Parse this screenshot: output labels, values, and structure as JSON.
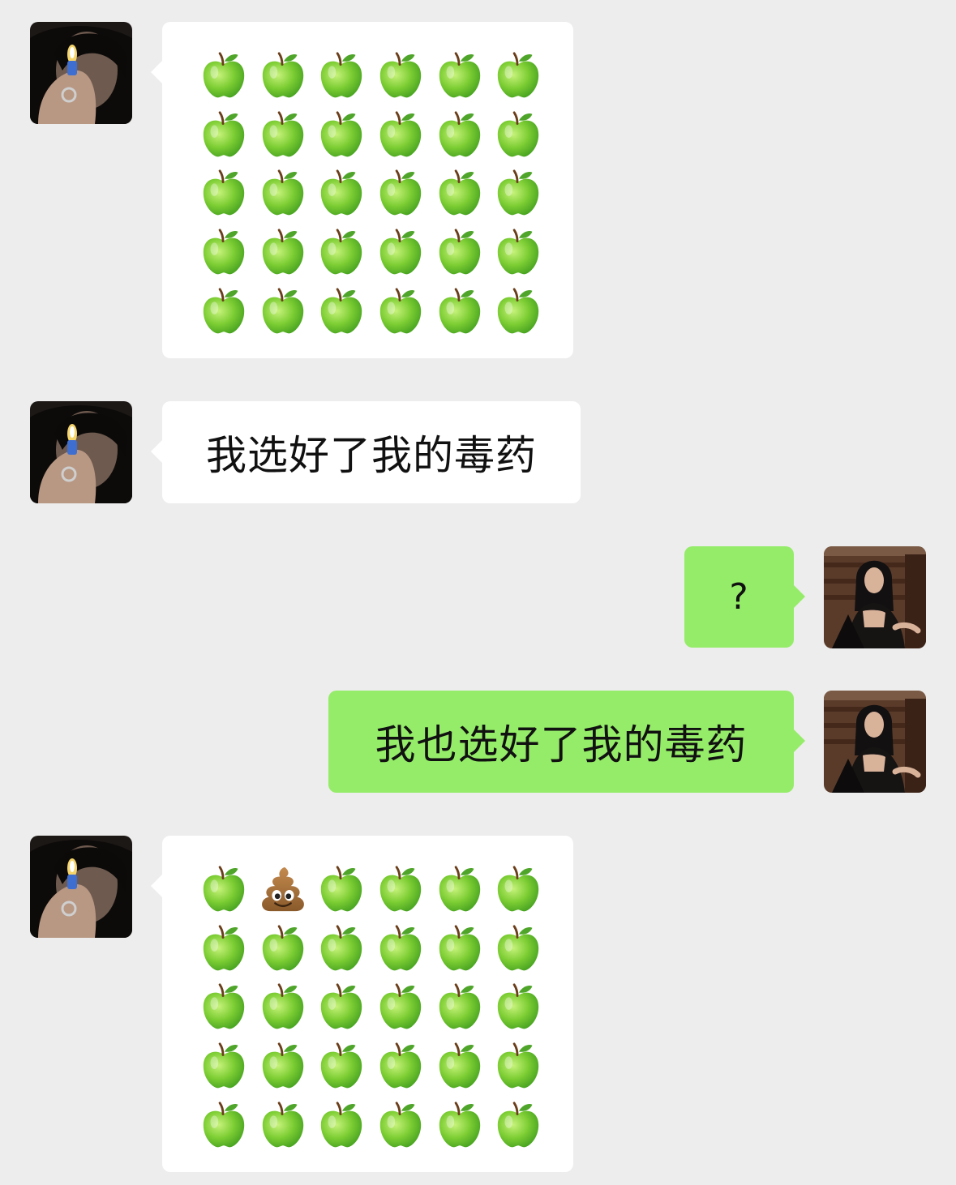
{
  "messages": [
    {
      "side": "left",
      "type": "emoji-grid",
      "items": [
        "apple",
        "apple",
        "apple",
        "apple",
        "apple",
        "apple",
        "apple",
        "apple",
        "apple",
        "apple",
        "apple",
        "apple",
        "apple",
        "apple",
        "apple",
        "apple",
        "apple",
        "apple",
        "apple",
        "apple",
        "apple",
        "apple",
        "apple",
        "apple",
        "apple",
        "apple",
        "apple",
        "apple",
        "apple",
        "apple"
      ]
    },
    {
      "side": "left",
      "type": "text",
      "text": "我选好了我的毒药"
    },
    {
      "side": "right",
      "type": "text",
      "text": "?"
    },
    {
      "side": "right",
      "type": "text",
      "text": "我也选好了我的毒药"
    },
    {
      "side": "left",
      "type": "emoji-grid",
      "items": [
        "apple",
        "poop",
        "apple",
        "apple",
        "apple",
        "apple",
        "apple",
        "apple",
        "apple",
        "apple",
        "apple",
        "apple",
        "apple",
        "apple",
        "apple",
        "apple",
        "apple",
        "apple",
        "apple",
        "apple",
        "apple",
        "apple",
        "apple",
        "apple",
        "apple",
        "apple",
        "apple",
        "apple",
        "apple",
        "apple"
      ]
    }
  ],
  "icons": {
    "apple": "green-apple-icon",
    "poop": "pile-of-poo-icon"
  },
  "colors": {
    "background": "#ededed",
    "incoming_bubble": "#ffffff",
    "outgoing_bubble": "#95ec69"
  }
}
